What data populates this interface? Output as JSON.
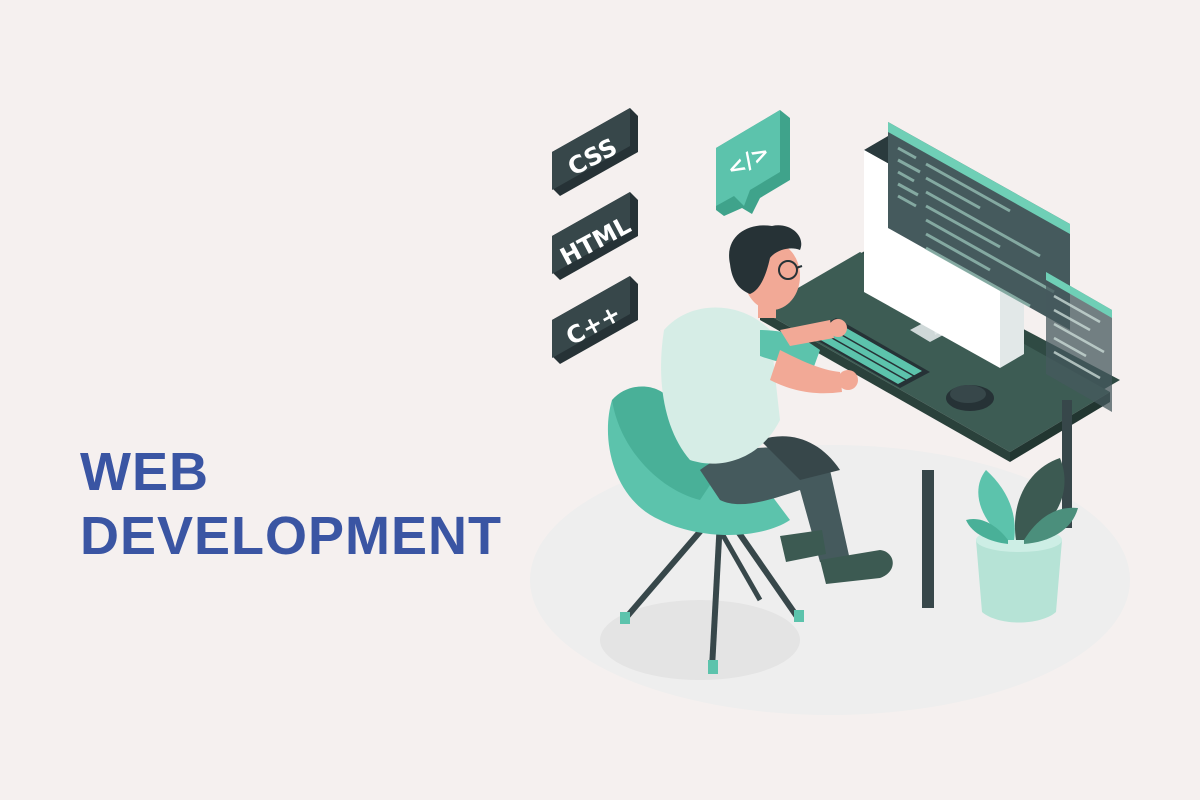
{
  "headline": {
    "line1": "WEB",
    "line2": "DEVELOPMENT"
  },
  "badges": {
    "css": "CSS",
    "html": "HTML",
    "cpp": "C++"
  },
  "code_bubble": {
    "label": "</>"
  },
  "colors": {
    "background": "#f5f0ef",
    "headline": "#3a55a3",
    "accent_teal": "#5cc3ac",
    "dark_green": "#3c5a52",
    "badge_dark": "#37474a"
  },
  "icons": [
    "css-tag-icon",
    "html-tag-icon",
    "cpp-tag-icon",
    "code-speech-bubble-icon",
    "developer-figure",
    "desk",
    "monitor",
    "side-screen",
    "keyboard",
    "mouse",
    "chair",
    "potted-plant"
  ]
}
